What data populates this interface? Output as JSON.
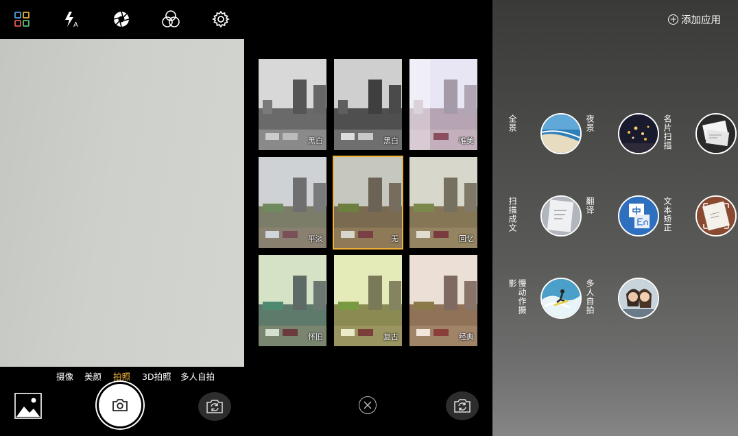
{
  "camera": {
    "top_icons": [
      "grid-icon",
      "flash-auto-icon",
      "aperture-icon",
      "filter-circles-icon",
      "settings-gear-icon"
    ],
    "modes": [
      {
        "label": "摄像",
        "active": false
      },
      {
        "label": "美颜",
        "active": false
      },
      {
        "label": "拍照",
        "active": true
      },
      {
        "label": "3D拍照",
        "active": false
      },
      {
        "label": "多人自拍",
        "active": false
      }
    ],
    "colors": {
      "active_mode": "#f5b83c",
      "background": "#000000"
    }
  },
  "filters": {
    "items": [
      {
        "label": "黑白",
        "style": "bw"
      },
      {
        "label": "黑白",
        "style": "bw2"
      },
      {
        "label": "唯美",
        "style": "dreamy"
      },
      {
        "label": "平淡",
        "style": "flat"
      },
      {
        "label": "无",
        "style": "none",
        "selected": true
      },
      {
        "label": "回忆",
        "style": "memory"
      },
      {
        "label": "怀旧",
        "style": "vintage"
      },
      {
        "label": "复古",
        "style": "retro"
      },
      {
        "label": "经典",
        "style": "classic"
      }
    ],
    "colors": {
      "selected_border": "#f0b03a"
    }
  },
  "apps": {
    "add_label": "添加应用",
    "items": [
      {
        "name": "全景",
        "icon": "panorama-beach-icon"
      },
      {
        "name": "夜景",
        "icon": "night-scene-icon"
      },
      {
        "name": "名片扫描",
        "icon": "business-card-icon"
      },
      {
        "name": "扫描成文",
        "icon": "scan-document-icon"
      },
      {
        "name": "翻译",
        "icon": "translate-icon"
      },
      {
        "name": "文本矫正",
        "icon": "text-correction-icon"
      },
      {
        "name": "慢动作摄影",
        "icon": "slow-motion-surfer-icon"
      },
      {
        "name": "多人自拍",
        "icon": "group-selfie-icon"
      }
    ]
  }
}
